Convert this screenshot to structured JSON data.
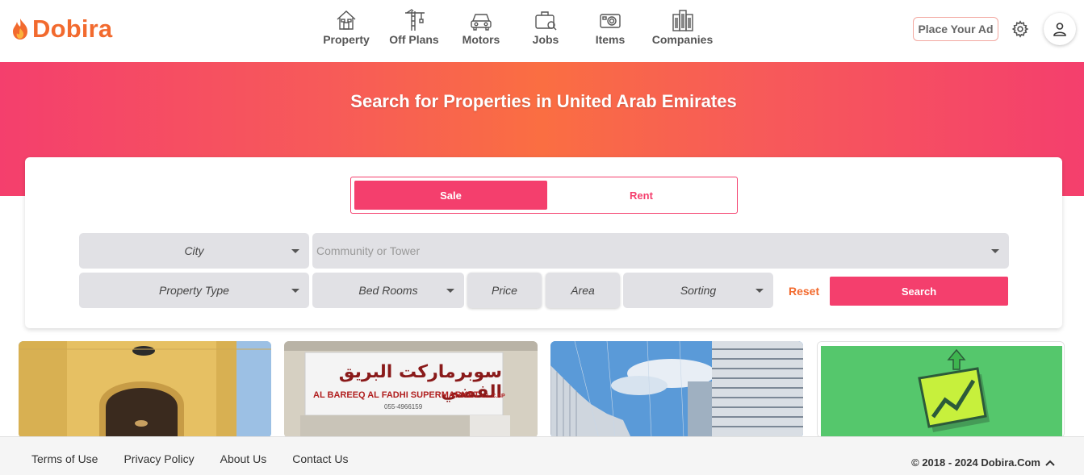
{
  "brand": {
    "name": "Dobira",
    "color": "#f26a2e"
  },
  "nav": [
    {
      "label": "Property",
      "icon": "house-icon"
    },
    {
      "label": "Off Plans",
      "icon": "crane-icon"
    },
    {
      "label": "Motors",
      "icon": "car-icon"
    },
    {
      "label": "Jobs",
      "icon": "briefcase-icon"
    },
    {
      "label": "Items",
      "icon": "camera-icon"
    },
    {
      "label": "Companies",
      "icon": "buildings-icon"
    }
  ],
  "header": {
    "place_ad": "Place Your Ad"
  },
  "hero": {
    "title": "Search for Properties in United Arab Emirates"
  },
  "search": {
    "toggle": {
      "sale": "Sale",
      "rent": "Rent",
      "active": "Sale"
    },
    "city": "City",
    "community_placeholder": "Community or Tower",
    "property_type": "Property Type",
    "bed_rooms": "Bed Rooms",
    "price": "Price",
    "area": "Area",
    "sorting": "Sorting",
    "reset": "Reset",
    "search": "Search"
  },
  "listings": {
    "l2_sign_arabic": "سوبرماركت البريق الفضي",
    "l2_sign_english": "AL BAREEQ AL FADHI SUPERMARKET",
    "l2_sign_suffix": "L.L.C.SP",
    "l2_sign_phone": "055-4966159"
  },
  "footer": {
    "links": [
      "Terms of Use",
      "Privacy Policy",
      "About Us",
      "Contact Us"
    ],
    "copyright": "© 2018 - 2024 Dobira.Com"
  },
  "colors": {
    "accent": "#f43f6d",
    "orange": "#f26a2e"
  }
}
